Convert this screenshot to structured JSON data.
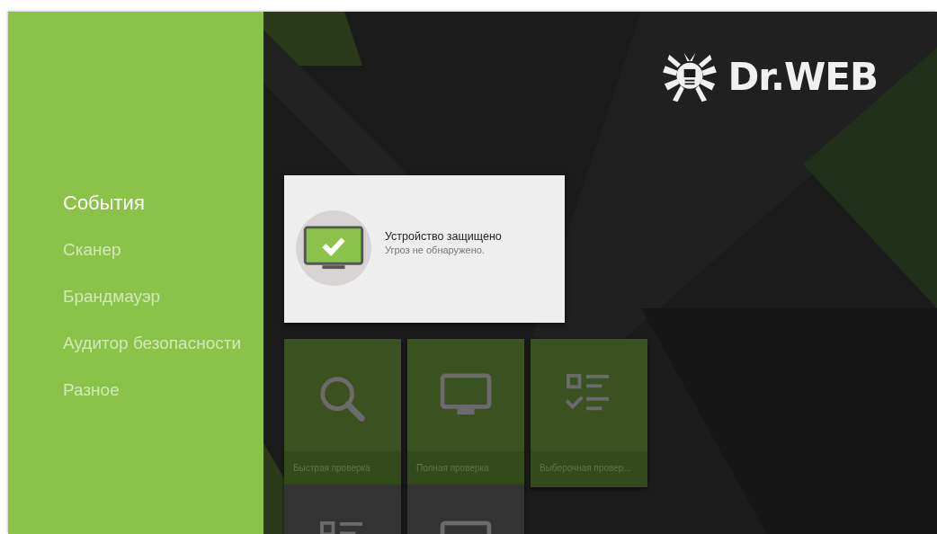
{
  "sidebar": {
    "items": [
      {
        "label": "События",
        "selected": true
      },
      {
        "label": "Сканер",
        "selected": false
      },
      {
        "label": "Брандмауэр",
        "selected": false
      },
      {
        "label": "Аудитор безопасности",
        "selected": false
      },
      {
        "label": "Разное",
        "selected": false
      }
    ]
  },
  "logo": {
    "text": "Dr.WEB"
  },
  "status_card": {
    "title": "Устройство защищено",
    "subtitle": "Угроз не обнаружено."
  },
  "scan_tiles": [
    {
      "kind": "search",
      "label": "Быстрая проверка"
    },
    {
      "kind": "monitor",
      "label": "Полная проверка"
    },
    {
      "kind": "checklist",
      "label": "Выборочная провер..."
    }
  ],
  "more_tiles": [
    {
      "kind": "checklist"
    },
    {
      "kind": "monitor"
    }
  ]
}
